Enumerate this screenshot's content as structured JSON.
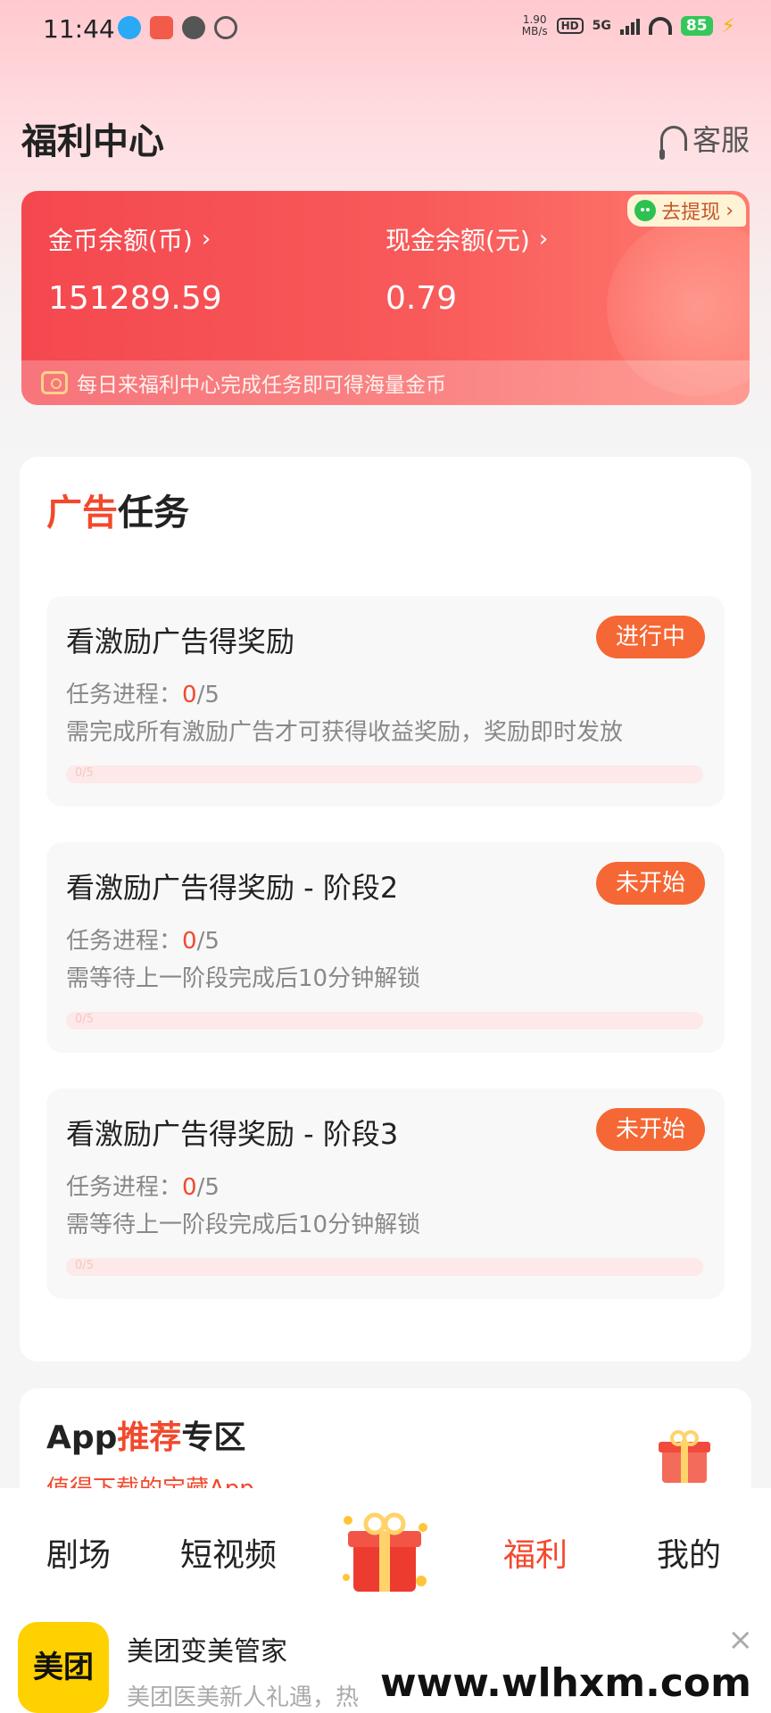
{
  "status_bar": {
    "time": "11:44",
    "speed": "1.90",
    "speed_unit": "MB/s",
    "hd": "HD",
    "network": "5G",
    "battery": "85"
  },
  "header": {
    "title": "福利中心",
    "service_label": "客服"
  },
  "balance": {
    "coin_label": "金币余额(币)",
    "coin_value": "151289.59",
    "cash_label": "现金余额(元)",
    "cash_value": "0.79",
    "withdraw_label": "去提现",
    "tip": "每日来福利中心完成任务即可得海量金币"
  },
  "ad_tasks": {
    "title_highlight": "广告",
    "title_rest": "任务",
    "progress_label": "任务进程：",
    "tasks": [
      {
        "title": "看激励广告得奖励",
        "status": "进行中",
        "done": "0",
        "total": "/5",
        "desc": "需完成所有激励广告才可获得收益奖励，奖励即时发放",
        "bar_label": "0/5",
        "progress": 0
      },
      {
        "title": "看激励广告得奖励 - 阶段2",
        "status": "未开始",
        "done": "0",
        "total": "/5",
        "desc": "需等待上一阶段完成后10分钟解锁",
        "bar_label": "0/5",
        "progress": 0
      },
      {
        "title": "看激励广告得奖励 - 阶段3",
        "status": "未开始",
        "done": "0",
        "total": "/5",
        "desc": "需等待上一阶段完成后10分钟解锁",
        "bar_label": "0/5",
        "progress": 0
      }
    ]
  },
  "app_recommend": {
    "title_prefix": "App",
    "title_highlight": "推荐",
    "title_suffix": "专区",
    "subtitle": "值得下载的宝藏App"
  },
  "bottom_nav": {
    "items": [
      "剧场",
      "短视频",
      "福利",
      "我的"
    ],
    "active": "福利"
  },
  "ad_banner": {
    "logo_text": "美团",
    "title": "美团变美管家",
    "subtitle": "美团医美新人礼遇，热",
    "close": "×"
  },
  "watermark": "www.wlhxm.com",
  "colors": {
    "accent": "#f2492d",
    "status_orange": "#f56734",
    "card_red": "#f4484f"
  }
}
